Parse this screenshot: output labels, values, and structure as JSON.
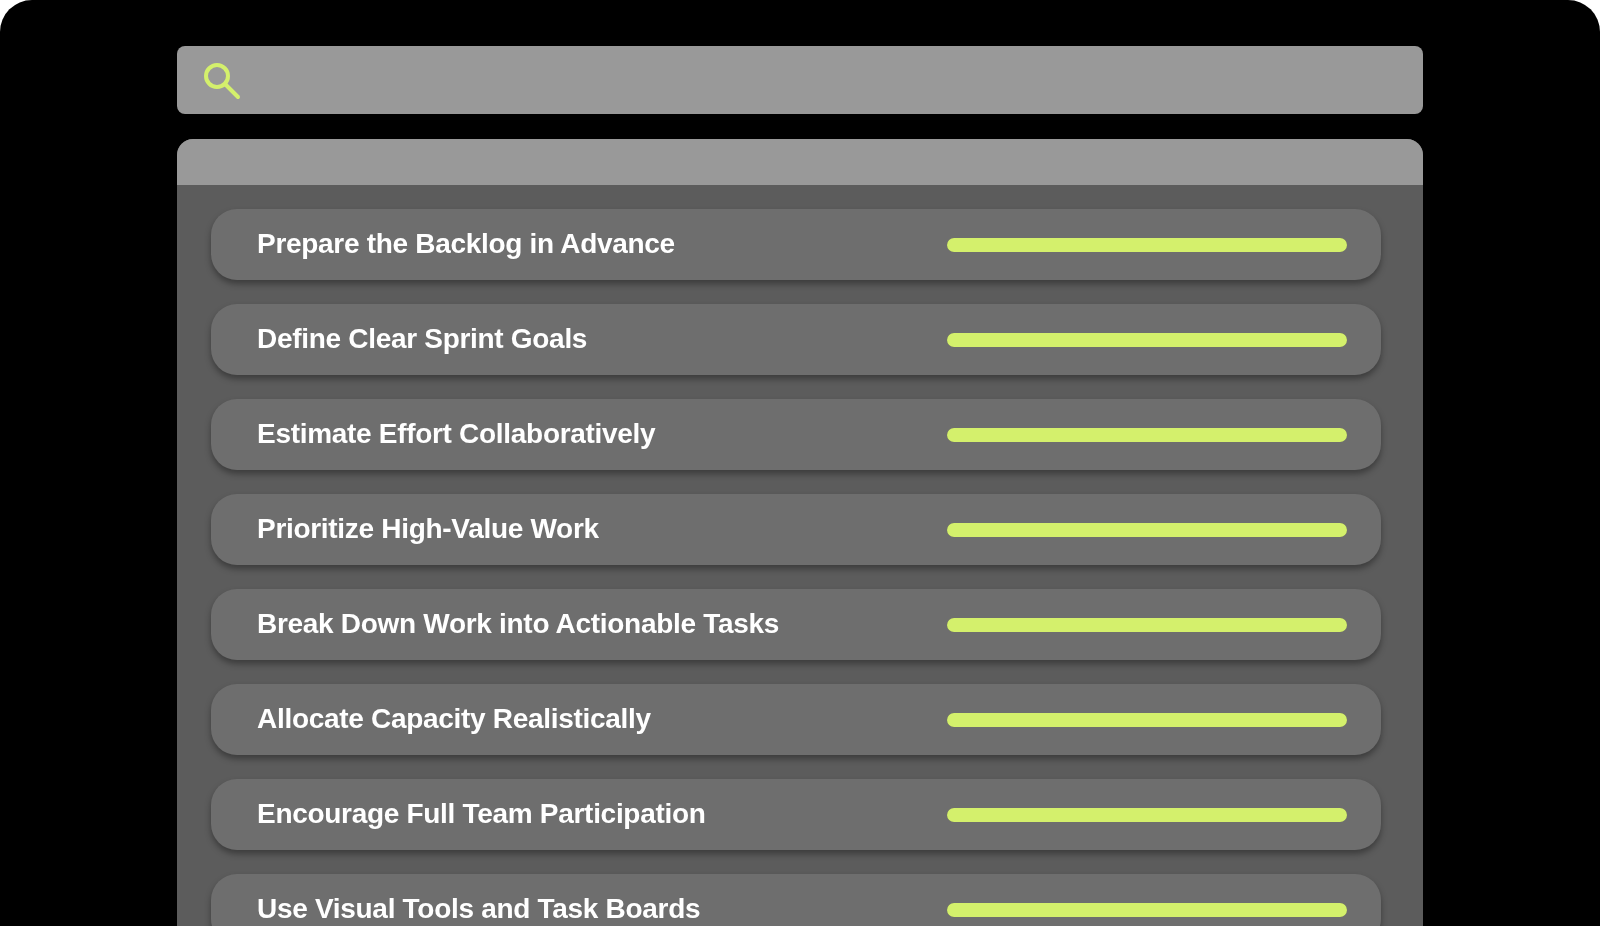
{
  "items": [
    {
      "label": "Prepare the Backlog in Advance",
      "level": 1
    },
    {
      "label": "Define Clear Sprint Goals",
      "level": 1
    },
    {
      "label": "Estimate Effort Collaboratively",
      "level": 1
    },
    {
      "label": "Prioritize High-Value Work",
      "level": 1
    },
    {
      "label": "Break Down Work into Actionable Tasks",
      "level": 1
    },
    {
      "label": "Allocate Capacity Realistically",
      "level": 1
    },
    {
      "label": "Encourage Full Team Participation",
      "level": 1
    },
    {
      "label": "Use Visual Tools and Task Boards",
      "level": 1
    }
  ]
}
